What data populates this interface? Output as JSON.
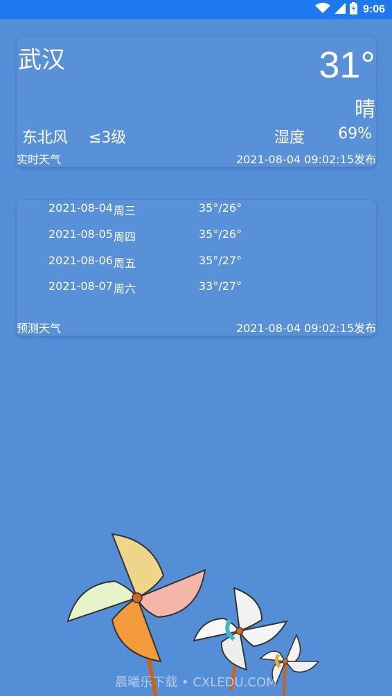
{
  "status_bar": {
    "time": "9:06"
  },
  "current": {
    "city": "武汉",
    "temperature": "31°",
    "condition": "晴",
    "wind_direction": "东北风",
    "wind_level": "≤3级",
    "humidity_label": "湿度",
    "humidity_value": "69%",
    "label": "实时天气",
    "published": "2021-08-04 09:02:15发布"
  },
  "forecast": {
    "rows": [
      {
        "date": "2021-08-04",
        "weekday": "周三",
        "range": "35°/26°"
      },
      {
        "date": "2021-08-05",
        "weekday": "周四",
        "range": "35°/26°"
      },
      {
        "date": "2021-08-06",
        "weekday": "周五",
        "range": "35°/27°"
      },
      {
        "date": "2021-08-07",
        "weekday": "周六",
        "range": "33°/27°"
      }
    ],
    "label": "预测天气",
    "published": "2021-08-04 09:02:15发布"
  },
  "watermark": "晨曦乐下载 • CXLEDU.COM",
  "colors": {
    "background": "#538ED7",
    "status_bar": "#1E78F0",
    "text": "#FFFFFF"
  },
  "icons": [
    "wifi-icon",
    "cell-signal-icon",
    "battery-icon",
    "pinwheel-illustration"
  ]
}
